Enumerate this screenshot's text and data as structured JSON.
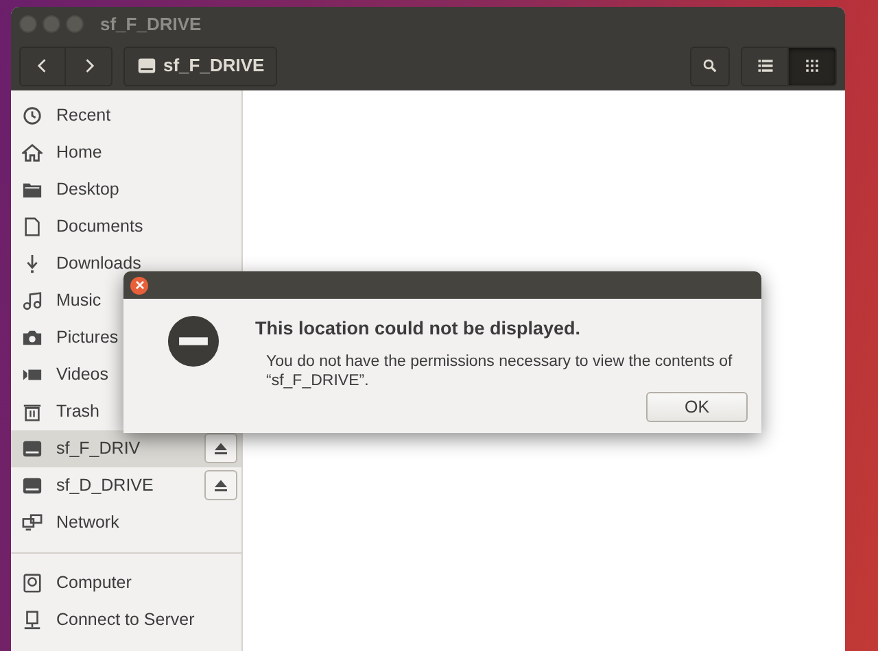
{
  "window": {
    "title": "sf_F_DRIVE"
  },
  "toolbar": {
    "nav_buttons": [
      {
        "kind": "back"
      },
      {
        "kind": "forward"
      }
    ],
    "path_button": {
      "label": "sf_F_DRIVE"
    },
    "view_buttons": [
      {
        "kind": "list",
        "selected": false
      },
      {
        "kind": "grid",
        "selected": true
      }
    ]
  },
  "sidebar": {
    "sections": [
      {
        "items": [
          {
            "label": "Recent",
            "selected": false,
            "eject": false
          },
          {
            "label": "Home",
            "selected": false,
            "eject": false
          },
          {
            "label": "Desktop",
            "selected": false,
            "eject": false
          },
          {
            "label": "Documents",
            "selected": false,
            "eject": false
          },
          {
            "label": "Downloads",
            "selected": false,
            "eject": false
          },
          {
            "label": "Music",
            "selected": false,
            "eject": false
          },
          {
            "label": "Pictures",
            "selected": false,
            "eject": false
          },
          {
            "label": "Videos",
            "selected": false,
            "eject": false
          },
          {
            "label": "Trash",
            "selected": false,
            "eject": false
          },
          {
            "label": "sf_F_DRIV",
            "selected": true,
            "eject": true
          },
          {
            "label": "sf_D_DRIVE",
            "selected": false,
            "eject": true
          },
          {
            "label": "Network",
            "selected": false,
            "eject": false
          }
        ]
      },
      {
        "items": [
          {
            "label": "Computer",
            "selected": false,
            "eject": false
          },
          {
            "label": "Connect to Server",
            "selected": false,
            "eject": false
          }
        ]
      }
    ]
  },
  "dialog": {
    "heading": "This location could not be displayed.",
    "message": "You do not have the permissions necessary to view the contents of “sf_F_DRIVE”.",
    "button": "OK"
  }
}
